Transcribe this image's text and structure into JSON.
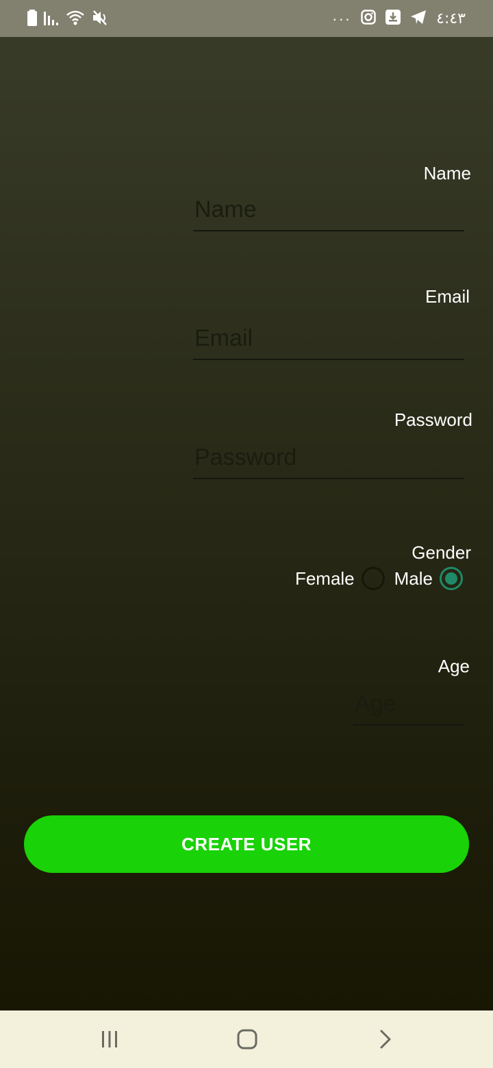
{
  "status_bar": {
    "time": "٤:٤٣",
    "left_icons": [
      "battery-icon",
      "signal-icon",
      "wifi-icon",
      "mute-icon"
    ],
    "right_icons": [
      "more-dots-icon",
      "instagram-icon",
      "download-icon",
      "telegram-icon"
    ],
    "more_dots": "···"
  },
  "form": {
    "name": {
      "label": "Name",
      "placeholder": "Name",
      "value": ""
    },
    "email": {
      "label": "Email",
      "placeholder": "Email",
      "value": ""
    },
    "password": {
      "label": "Password",
      "placeholder": "Password",
      "value": ""
    },
    "gender": {
      "label": "Gender",
      "options": [
        "Female",
        "Male"
      ],
      "selected": "Male"
    },
    "age": {
      "label": "Age",
      "placeholder": "Age",
      "value": ""
    }
  },
  "create_button": {
    "label": "CREATE USER"
  },
  "colors": {
    "accent_button": "#19d207",
    "radio_checked": "#1f8a67",
    "nav_bar": "#f3f0dc",
    "status_bar": "#828170"
  },
  "nav_bar": {
    "buttons": [
      "recent-apps-icon",
      "home-icon",
      "back-icon"
    ]
  }
}
